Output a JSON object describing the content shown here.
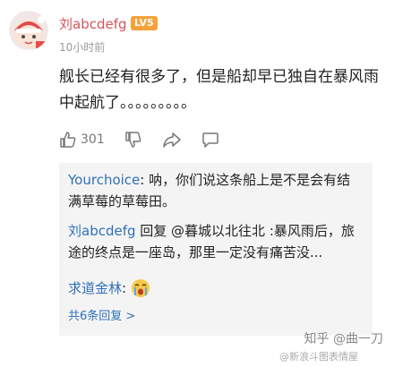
{
  "comment": {
    "username": "刘abcdefg",
    "level": "LV5",
    "time": "10小时前",
    "content": "舰长已经有很多了，但是船却早已独自在暴风雨中起航了。。。。。。。。。",
    "likes": "301"
  },
  "replies": [
    {
      "name": "Yourchoice",
      "text": ": 呐，你们说这条船上是不是会有结满草莓的草莓田。"
    },
    {
      "name": "刘abcdefg",
      "text": " 回复 @暮城以北往北 :暴风雨后，旅途的终点是一座岛，那里一定没有痛苦没..."
    },
    {
      "name": "求道金林",
      "text": ":"
    }
  ],
  "more": "共6条回复 >",
  "watermark": "知乎 @曲一刀",
  "watermark2": "@新浪斗图表情屋"
}
